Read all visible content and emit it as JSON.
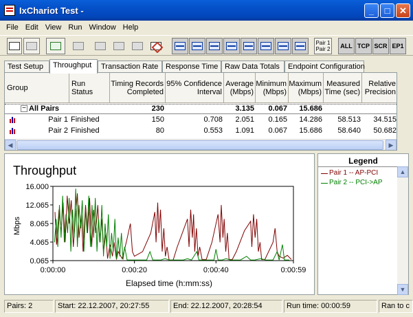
{
  "window": {
    "title": "IxChariot Test -"
  },
  "menu": [
    "File",
    "Edit",
    "View",
    "Run",
    "Window",
    "Help"
  ],
  "toolbar": {
    "pair_label_1": "Pair 1",
    "pair_label_2": "Pair 2",
    "all": "ALL",
    "tcp": "TCP",
    "scr": "SCR",
    "ep1": "EP1"
  },
  "tabs": [
    "Test Setup",
    "Throughput",
    "Transaction Rate",
    "Response Time",
    "Raw Data Totals",
    "Endpoint Configuration"
  ],
  "table": {
    "headers": {
      "group": "Group",
      "run_status": "Run Status",
      "timing_records": "Timing Records Completed",
      "confidence": "95% Confidence Interval",
      "average": "Average (Mbps)",
      "minimum": "Minimum (Mbps)",
      "maximum": "Maximum (Mbps)",
      "measured_time": "Measured Time (sec)",
      "relative_precision": "Relative Precision"
    },
    "all_pairs": {
      "label": "All Pairs",
      "toggle": "−",
      "timing_records": "230",
      "average": "3.135",
      "minimum": "0.067",
      "maximum": "15.686"
    },
    "rows": [
      {
        "group": "Pair 1",
        "status": "Finished",
        "timing_records": "150",
        "confidence": "0.708",
        "average": "2.051",
        "minimum": "0.165",
        "maximum": "14.286",
        "measured_time": "58.513",
        "relative_precision": "34.515"
      },
      {
        "group": "Pair 2",
        "status": "Finished",
        "timing_records": "80",
        "confidence": "0.553",
        "average": "1.091",
        "minimum": "0.067",
        "maximum": "15.686",
        "measured_time": "58.640",
        "relative_precision": "50.682"
      }
    ]
  },
  "legend": {
    "title": "Legend",
    "items": [
      {
        "label": "Pair 1 -- AP-PCI",
        "color": "#800000"
      },
      {
        "label": "Pair 2 -- PCI->AP",
        "color": "#008000"
      }
    ]
  },
  "status": {
    "pairs": "Pairs: 2",
    "start": "Start: 22.12.2007, 20:27:55",
    "end": "End: 22.12.2007, 20:28:54",
    "run_time": "Run time: 00:00:59",
    "ran_to": "Ran to c"
  },
  "chart_data": {
    "type": "line",
    "title": "Throughput",
    "xlabel": "Elapsed time (h:mm:ss)",
    "ylabel": "Mbps",
    "x_ticks": [
      "0:00:00",
      "0:00:20",
      "0:00:40",
      "0:00:59"
    ],
    "y_ticks": [
      "16.000",
      "12.065",
      "8.065",
      "4.065",
      "0.065"
    ],
    "xlim": [
      0,
      59
    ],
    "ylim": [
      0.065,
      16.0
    ],
    "grid": false,
    "series": [
      {
        "name": "Pair 1 -- AP-PCI",
        "color": "#800000",
        "points": [
          [
            0.5,
            10.5
          ],
          [
            0.9,
            3.5
          ],
          [
            1.5,
            11
          ],
          [
            2,
            6
          ],
          [
            2.5,
            12.5
          ],
          [
            3,
            4
          ],
          [
            3.5,
            14
          ],
          [
            4,
            8
          ],
          [
            4.5,
            13
          ],
          [
            5,
            3
          ],
          [
            5.5,
            9
          ],
          [
            6,
            14.5
          ],
          [
            6.4,
            5
          ],
          [
            7,
            10
          ],
          [
            7.4,
            2
          ],
          [
            8,
            12
          ],
          [
            8.5,
            6
          ],
          [
            9,
            13.5
          ],
          [
            9.5,
            3
          ],
          [
            10,
            11
          ],
          [
            10.5,
            6
          ],
          [
            11,
            12
          ],
          [
            11.5,
            4
          ],
          [
            12,
            9
          ],
          [
            12.4,
            2
          ],
          [
            13,
            6
          ],
          [
            13.4,
            0.5
          ],
          [
            14,
            3.5
          ],
          [
            14.6,
            1
          ],
          [
            15,
            4
          ],
          [
            15.6,
            0.3
          ],
          [
            16,
            2
          ],
          [
            17,
            0.5
          ],
          [
            18,
            4
          ],
          [
            19,
            8
          ],
          [
            19.5,
            2
          ],
          [
            20,
            1
          ],
          [
            22,
            2
          ],
          [
            24,
            6
          ],
          [
            25,
            10.5
          ],
          [
            25.3,
            4
          ],
          [
            25.7,
            12.5
          ],
          [
            26,
            6
          ],
          [
            26.4,
            11
          ],
          [
            26.8,
            2
          ],
          [
            27.2,
            7
          ],
          [
            27.6,
            1
          ],
          [
            28,
            3
          ],
          [
            28.5,
            0.2
          ],
          [
            29.5,
            0.2
          ],
          [
            30.5,
            3
          ],
          [
            33,
            9
          ],
          [
            33.4,
            3
          ],
          [
            33.8,
            11
          ],
          [
            34.2,
            5
          ],
          [
            34.5,
            10
          ],
          [
            34.8,
            2
          ],
          [
            35.2,
            7
          ],
          [
            35.6,
            1
          ],
          [
            36,
            3
          ],
          [
            36.6,
            0.3
          ],
          [
            37.6,
            0.3
          ],
          [
            39,
            4
          ],
          [
            40.5,
            10
          ],
          [
            41,
            4
          ],
          [
            41.3,
            12
          ],
          [
            41.7,
            5
          ],
          [
            42,
            9
          ],
          [
            42.4,
            2
          ],
          [
            42.8,
            6
          ],
          [
            43.2,
            0.3
          ],
          [
            44,
            0.3
          ],
          [
            45,
            2
          ],
          [
            47,
            6.5
          ],
          [
            48.5,
            8.5
          ],
          [
            48.8,
            3
          ],
          [
            49.2,
            10
          ],
          [
            49.6,
            5
          ],
          [
            50,
            9
          ],
          [
            50.4,
            2
          ],
          [
            50.8,
            4
          ],
          [
            51.2,
            0.3
          ],
          [
            52,
            0.3
          ],
          [
            54,
            4
          ],
          [
            54.5,
            7
          ],
          [
            55,
            2
          ],
          [
            55.5,
            1
          ],
          [
            56.5,
            0.6
          ],
          [
            57.5,
            1.2
          ],
          [
            58.5,
            0.3
          ]
        ]
      },
      {
        "name": "Pair 2 -- PCI->AP",
        "color": "#008000",
        "points": [
          [
            0.4,
            4
          ],
          [
            0.8,
            9
          ],
          [
            1.2,
            3
          ],
          [
            1.6,
            12
          ],
          [
            2,
            5
          ],
          [
            2.4,
            14
          ],
          [
            2.8,
            4
          ],
          [
            3.2,
            10
          ],
          [
            3.6,
            6
          ],
          [
            4,
            13.5
          ],
          [
            4.4,
            2
          ],
          [
            4.8,
            11
          ],
          [
            5.2,
            5
          ],
          [
            5.6,
            15.5
          ],
          [
            6,
            3
          ],
          [
            6.4,
            12
          ],
          [
            6.8,
            7
          ],
          [
            7.2,
            13
          ],
          [
            7.6,
            2
          ],
          [
            8,
            11
          ],
          [
            8.4,
            6
          ],
          [
            8.8,
            14
          ],
          [
            9.2,
            3
          ],
          [
            9.6,
            12
          ],
          [
            10,
            5
          ],
          [
            10.4,
            13.5
          ],
          [
            10.8,
            2
          ],
          [
            11.2,
            9
          ],
          [
            11.6,
            4
          ],
          [
            12,
            12
          ],
          [
            12.4,
            1
          ],
          [
            12.8,
            8
          ],
          [
            13.2,
            3
          ],
          [
            13.6,
            10
          ],
          [
            14,
            0.5
          ],
          [
            14.4,
            6
          ],
          [
            14.8,
            2
          ],
          [
            15.2,
            9
          ],
          [
            15.6,
            0.4
          ],
          [
            16,
            5
          ],
          [
            16.4,
            1
          ],
          [
            16.8,
            6
          ],
          [
            17.2,
            0.3
          ],
          [
            17.6,
            3
          ],
          [
            18.2,
            0.2
          ],
          [
            19,
            0.2
          ],
          [
            20,
            0.2
          ],
          [
            21,
            0.2
          ],
          [
            22,
            0.2
          ],
          [
            23,
            0.2
          ],
          [
            23.8,
            2
          ],
          [
            24.5,
            0.2
          ],
          [
            25.5,
            0.2
          ],
          [
            26.5,
            0.2
          ],
          [
            27.5,
            0.5
          ],
          [
            28.5,
            0.2
          ],
          [
            30,
            0.2
          ],
          [
            31,
            0.2
          ],
          [
            32,
            0.2
          ],
          [
            33,
            0.5
          ],
          [
            34,
            0.2
          ],
          [
            35.3,
            2
          ],
          [
            35.8,
            0.2
          ],
          [
            37,
            0.2
          ],
          [
            38,
            0.2
          ],
          [
            39.5,
            0.2
          ],
          [
            40,
            2.5
          ],
          [
            40.5,
            0.2
          ],
          [
            41.5,
            0.2
          ],
          [
            42.5,
            0.5
          ],
          [
            43.5,
            0.2
          ],
          [
            45,
            0.2
          ],
          [
            46,
            0.2
          ],
          [
            47.5,
            1
          ],
          [
            48.5,
            0.2
          ],
          [
            49.5,
            0.2
          ],
          [
            51,
            0.5
          ],
          [
            52.2,
            0.2
          ],
          [
            53,
            0.2
          ],
          [
            54,
            0.2
          ],
          [
            55,
            2
          ],
          [
            55.5,
            0.2
          ],
          [
            56.3,
            3.5
          ],
          [
            56.8,
            0.2
          ],
          [
            58,
            0.2
          ]
        ]
      }
    ]
  }
}
